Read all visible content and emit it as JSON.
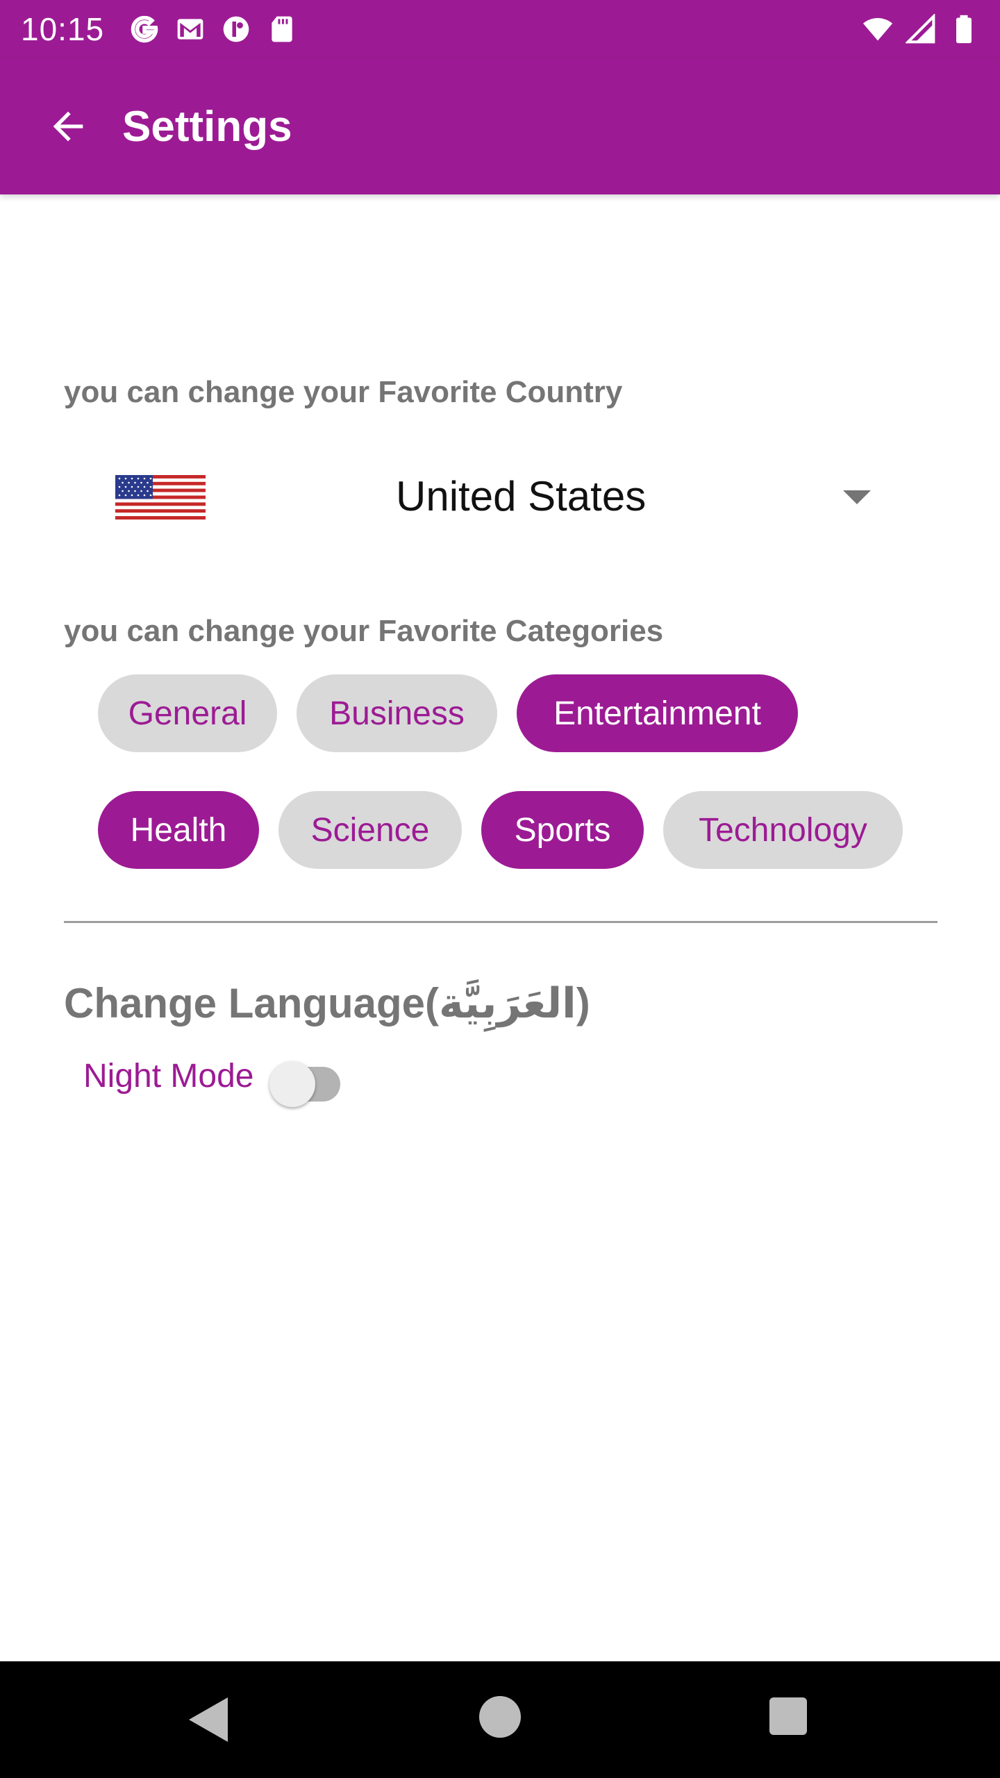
{
  "status_bar": {
    "time": "10:15",
    "left_icons": [
      "google-icon",
      "gmail-icon",
      "app-notification-icon",
      "sd-card-icon"
    ],
    "right_icons": [
      "wifi-icon",
      "cellular-signal-icon",
      "battery-icon"
    ]
  },
  "app_bar": {
    "title": "Settings",
    "back_icon": "arrow-back-icon",
    "background": "#9c1b94"
  },
  "country_section": {
    "label": "you can change your Favorite Country",
    "selected_country": "United States",
    "flag_icon": "us-flag-icon"
  },
  "categories_section": {
    "label": "you can change your Favorite Categories",
    "chips": [
      {
        "label": "General",
        "selected": false
      },
      {
        "label": "Business",
        "selected": false
      },
      {
        "label": "Entertainment",
        "selected": true
      },
      {
        "label": "Health",
        "selected": true
      },
      {
        "label": "Science",
        "selected": false
      },
      {
        "label": "Sports",
        "selected": true
      },
      {
        "label": "Technology",
        "selected": false
      }
    ]
  },
  "language": {
    "label": "Change Language(العَرَبِيَّة)"
  },
  "night_mode": {
    "label": "Night Mode",
    "enabled": false
  },
  "colors": {
    "accent": "#9c1b94",
    "chip_unselected": "#d9d9d9",
    "section_label": "#757575"
  }
}
